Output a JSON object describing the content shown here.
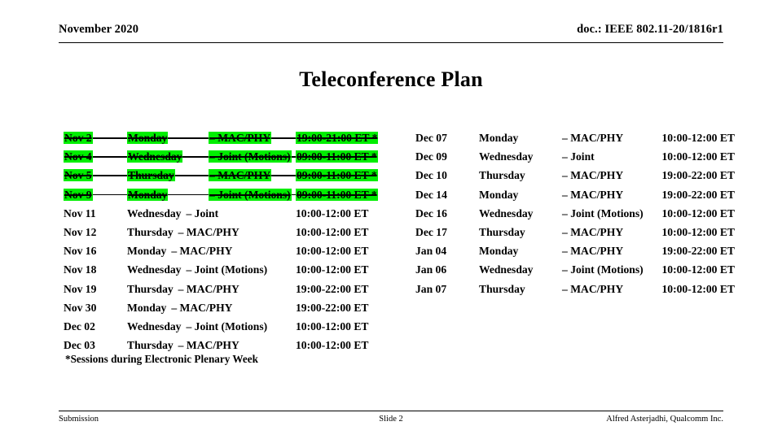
{
  "header": {
    "left": "November 2020",
    "right": "doc.: IEEE 802.11-20/1816r1"
  },
  "title": "Teleconference Plan",
  "highlight_color": "#00ee00",
  "schedule": {
    "left_column": [
      {
        "date": "Nov 2",
        "day": "Monday",
        "type": "– MAC/PHY",
        "time": "19:00-21:00 ET *",
        "struck": true,
        "highlighted": true
      },
      {
        "date": "Nov 4",
        "day": "Wednesday",
        "type": "– Joint (Motions)",
        "time": "09:00-11:00 ET *",
        "struck": true,
        "highlighted": true
      },
      {
        "date": "Nov 5",
        "day": "Thursday",
        "type": "– MAC/PHY",
        "time": "09:00-11:00 ET *",
        "struck": true,
        "highlighted": true
      },
      {
        "date": "Nov 9",
        "day": "Monday",
        "type": "– Joint (Motions)",
        "time": "09:00-11:00 ET *",
        "struck": true,
        "highlighted": true
      },
      {
        "date": "Nov 11",
        "day": "Wednesday",
        "type": "– Joint",
        "time": "10:00-12:00 ET",
        "struck": false,
        "highlighted": false
      },
      {
        "date": "Nov 12",
        "day": "Thursday",
        "type": "– MAC/PHY",
        "time": "10:00-12:00 ET",
        "struck": false,
        "highlighted": false
      },
      {
        "date": "Nov 16",
        "day": "Monday",
        "type": "– MAC/PHY",
        "time": "10:00-12:00 ET",
        "struck": false,
        "highlighted": false
      },
      {
        "date": "Nov 18",
        "day": "Wednesday",
        "type": "– Joint (Motions)",
        "time": "10:00-12:00 ET",
        "struck": false,
        "highlighted": false
      },
      {
        "date": "Nov 19",
        "day": "Thursday",
        "type": "– MAC/PHY",
        "time": "19:00-22:00 ET",
        "struck": false,
        "highlighted": false
      },
      {
        "date": "Nov 30",
        "day": "Monday",
        "type": "– MAC/PHY",
        "time": "19:00-22:00 ET",
        "struck": false,
        "highlighted": false
      },
      {
        "date": "Dec 02",
        "day": "Wednesday",
        "type": "– Joint (Motions)",
        "time": "10:00-12:00 ET",
        "struck": false,
        "highlighted": false
      },
      {
        "date": "Dec 03",
        "day": "Thursday",
        "type": "– MAC/PHY",
        "time": "10:00-12:00 ET",
        "struck": false,
        "highlighted": false
      }
    ],
    "right_column": [
      {
        "date": "Dec 07",
        "day": "Monday",
        "type": "– MAC/PHY",
        "time": "10:00-12:00 ET"
      },
      {
        "date": "Dec 09",
        "day": "Wednesday",
        "type": "– Joint",
        "time": "10:00-12:00 ET"
      },
      {
        "date": "Dec 10",
        "day": "Thursday",
        "type": "– MAC/PHY",
        "time": "19:00-22:00 ET"
      },
      {
        "date": "Dec 14",
        "day": "Monday",
        "type": "– MAC/PHY",
        "time": "19:00-22:00 ET"
      },
      {
        "date": "Dec 16",
        "day": "Wednesday",
        "type": "– Joint (Motions)",
        "time": "10:00-12:00 ET"
      },
      {
        "date": "Dec 17",
        "day": "Thursday",
        "type": "– MAC/PHY",
        "time": "10:00-12:00 ET"
      },
      {
        "date": "Jan 04",
        "day": "Monday",
        "type": "– MAC/PHY",
        "time": "19:00-22:00 ET"
      },
      {
        "date": "Jan 06",
        "day": "Wednesday",
        "type": "– Joint (Motions)",
        "time": "10:00-12:00 ET"
      },
      {
        "date": "Jan 07",
        "day": "Thursday",
        "type": "– MAC/PHY",
        "time": "10:00-12:00 ET"
      }
    ]
  },
  "footnote": "*Sessions during Electronic Plenary Week",
  "footer": {
    "left": "Submission",
    "center": "Slide 2",
    "right": "Alfred Asterjadhi, Qualcomm Inc."
  }
}
